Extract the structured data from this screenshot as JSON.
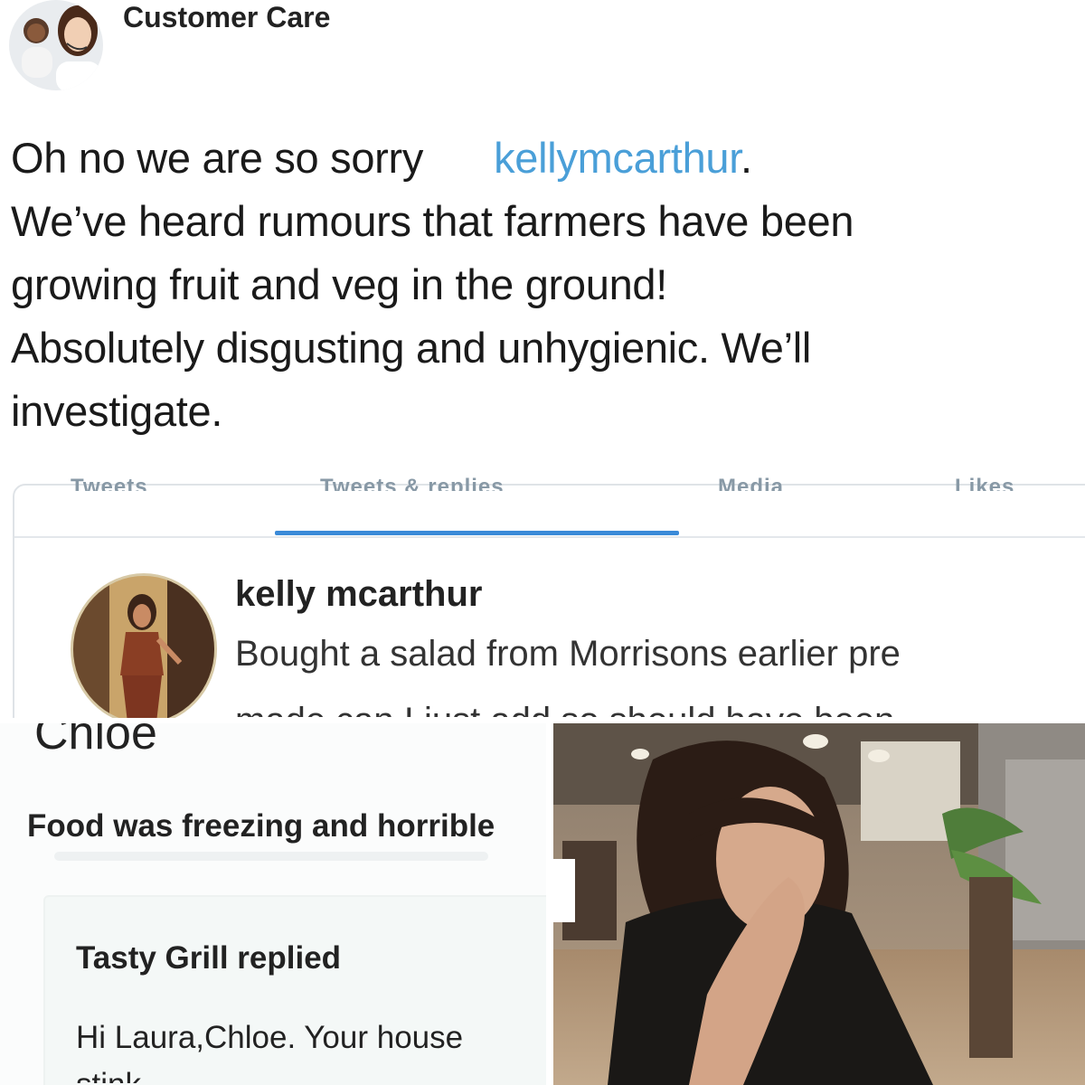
{
  "top_tweet": {
    "account_name": "Customer Care",
    "line1": "Oh no we are so sorry",
    "mention": "kellymcarthur",
    "mention_suffix": ".",
    "line2": "We’ve heard rumours that farmers have been",
    "line3": "growing fruit and veg in the ground!",
    "line4": "Absolutely disgusting and unhygienic. We’ll",
    "line5": "investigate."
  },
  "profile": {
    "tabs": [
      "Tweets",
      "Tweets & replies",
      "Media",
      "Likes"
    ],
    "active_tab_index": 1,
    "reply": {
      "name": "kelly mcarthur",
      "text": "Bought a salad from Morrisons earlier pre",
      "cut_text": "made can I just add so should have been"
    }
  },
  "review": {
    "reviewer_name": "Chloe",
    "review_text": "Food was freezing and horrible",
    "replied_title": "Tasty Grill replied",
    "replied_text": "Hi Laura,Chloe. Your house",
    "replied_cut": "stink"
  },
  "colors": {
    "mention": "#4a9fd8",
    "tab_active": "#3a8ad8"
  }
}
